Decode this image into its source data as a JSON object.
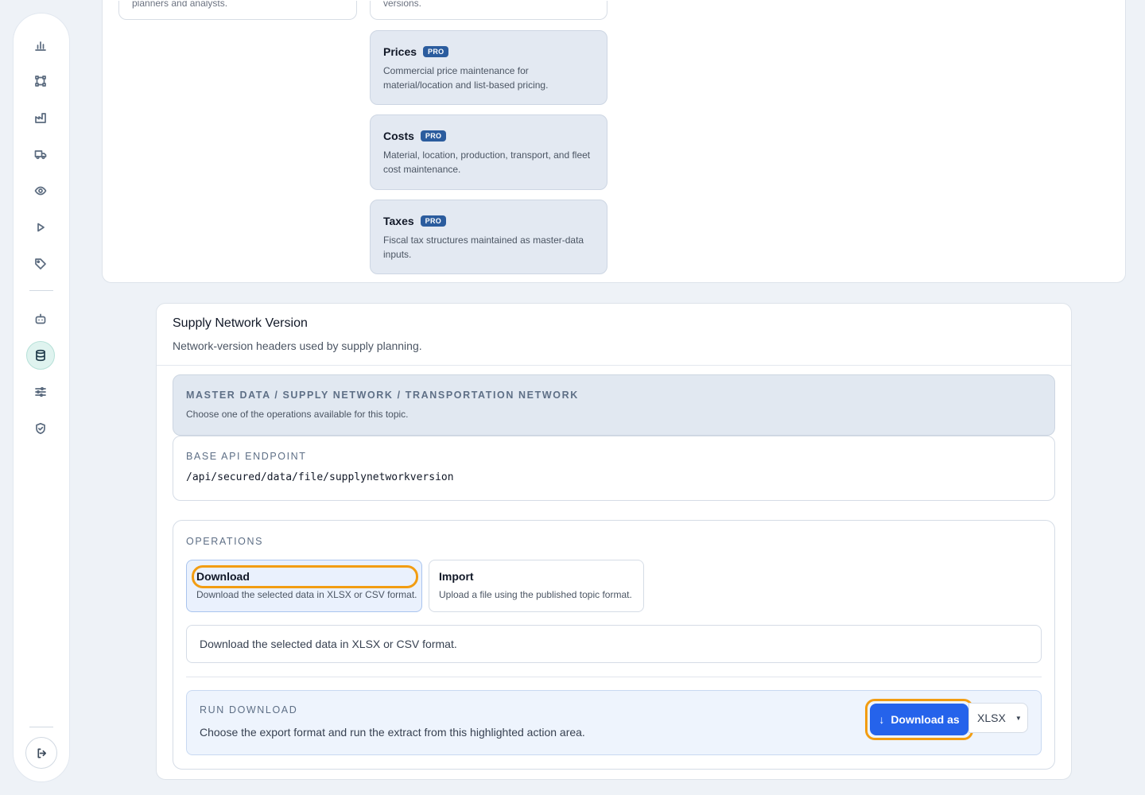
{
  "sidebar": {
    "items": [
      {
        "icon": "bar-chart-icon"
      },
      {
        "icon": "network-nodes-icon"
      },
      {
        "icon": "factory-icon"
      },
      {
        "icon": "truck-icon"
      },
      {
        "icon": "eye-icon"
      },
      {
        "icon": "play-icon"
      },
      {
        "icon": "tag-icon"
      },
      {
        "icon": "robot-icon"
      },
      {
        "icon": "database-icon",
        "active": true
      },
      {
        "icon": "sliders-icon"
      },
      {
        "icon": "shield-check-icon"
      }
    ],
    "logout_icon": "logout-icon"
  },
  "top_panel": {
    "stub_left": "planners and analysts.",
    "stub_right": "versions.",
    "topics": [
      {
        "title": "Prices",
        "badge": "PRO",
        "description": "Commercial price maintenance for material/location and list-based pricing."
      },
      {
        "title": "Costs",
        "badge": "PRO",
        "description": "Material, location, production, transport, and fleet cost maintenance."
      },
      {
        "title": "Taxes",
        "badge": "PRO",
        "description": "Fiscal tax structures maintained as master-data inputs."
      }
    ]
  },
  "main": {
    "title": "Supply Network Version",
    "subtitle": "Network-version headers used by supply planning.",
    "path": "MASTER DATA / SUPPLY NETWORK / TRANSPORTATION NETWORK",
    "path_hint": "Choose one of the operations available for this topic.",
    "endpoint_label": "BASE API ENDPOINT",
    "endpoint_value": "/api/secured/data/file/supplynetworkversion",
    "operations_label": "OPERATIONS",
    "operations": [
      {
        "title": "Download",
        "description": "Download the selected data in XLSX or CSV format.",
        "selected": true
      },
      {
        "title": "Import",
        "description": "Upload a file using the published topic format.",
        "selected": false
      }
    ],
    "operation_description": "Download the selected data in XLSX or CSV format.",
    "run": {
      "label": "RUN DOWNLOAD",
      "hint": "Choose the export format and run the extract from this highlighted action area.",
      "button_icon": "↓",
      "button_label": "Download as",
      "format_value": "XLSX",
      "format_caret": "▼"
    }
  },
  "colors": {
    "accent": "#2563eb",
    "focus_ring": "#f29d12",
    "pro_badge": "#2b5c9e",
    "active_nav": "#dff3ef"
  }
}
